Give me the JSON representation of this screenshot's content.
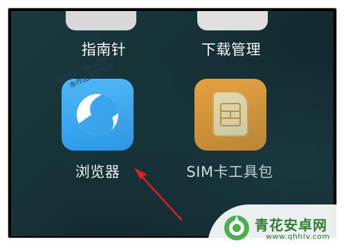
{
  "apps": {
    "top_left_label": "指南针",
    "top_right_label": "下载管理",
    "browser_label": "浏览器",
    "sim_label": "SIM卡工具包"
  },
  "watermark": {
    "line1": "百度ID：随心仔仔",
    "line2": "本作品原创作者"
  },
  "site": {
    "name": "青花安卓网",
    "url": "www.qhhlv.com"
  },
  "colors": {
    "browser_blue": "#3aa6f3",
    "sim_orange": "#f39a2e",
    "arrow_red": "#e02020",
    "site_green": "#2e7d32"
  }
}
